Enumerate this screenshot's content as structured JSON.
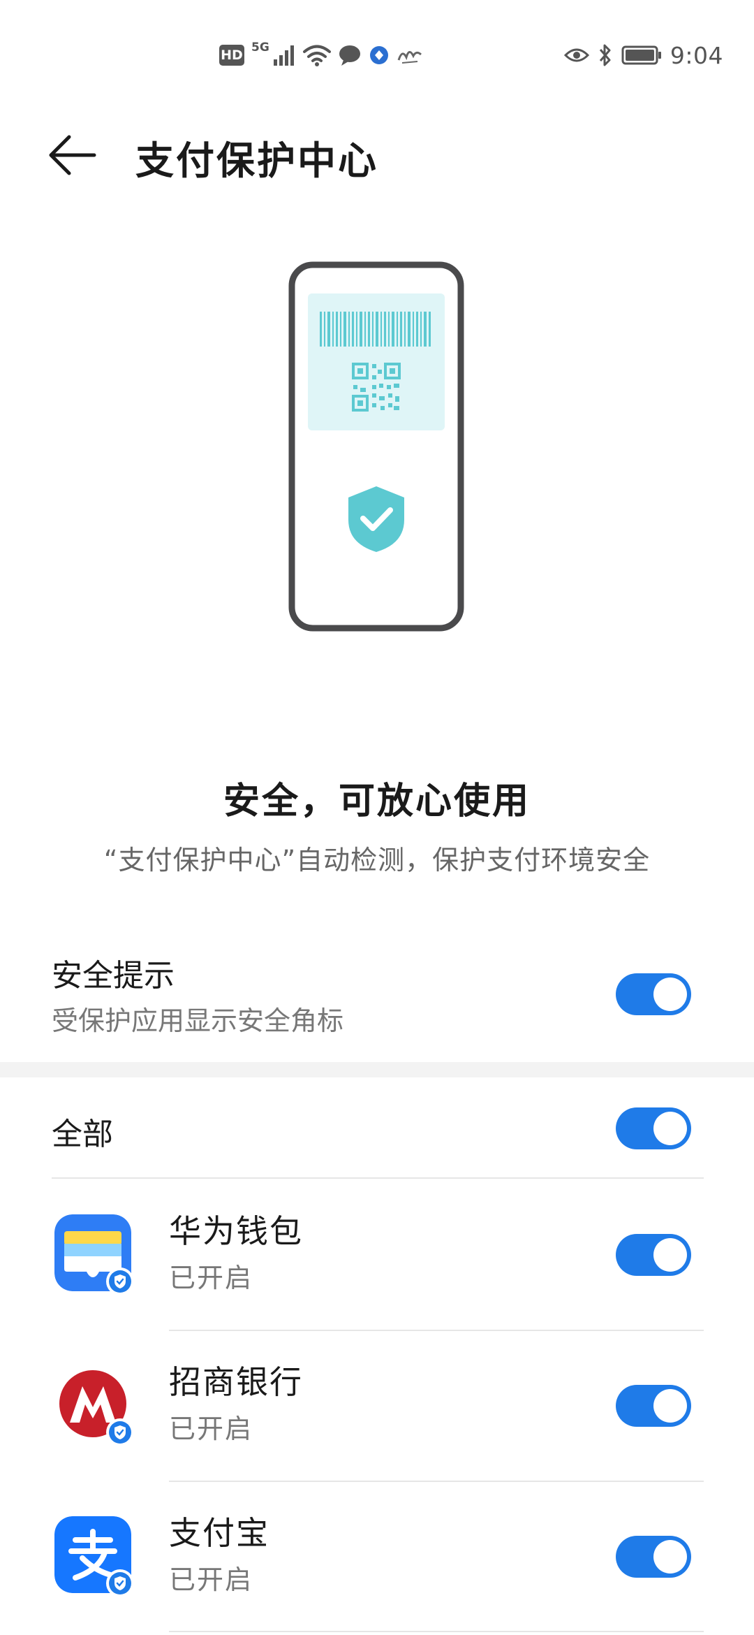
{
  "status_bar": {
    "network_badge": "HD",
    "network_type": "5G",
    "time": "9:04"
  },
  "header": {
    "title": "支付保护中心"
  },
  "status": {
    "title": "安全，可放心使用",
    "subtitle": "“支付保护中心”自动检测，保护支付环境安全"
  },
  "security_tip": {
    "title": "安全提示",
    "description": "受保护应用显示安全角标",
    "enabled": true
  },
  "all_toggle": {
    "label": "全部",
    "enabled": true
  },
  "apps": [
    {
      "name": "华为钱包",
      "status": "已开启",
      "icon": "huawei-wallet-icon",
      "enabled": true
    },
    {
      "name": "招商银行",
      "status": "已开启",
      "icon": "cmb-bank-icon",
      "enabled": true
    },
    {
      "name": "支付宝",
      "status": "已开启",
      "icon": "alipay-icon",
      "enabled": true
    }
  ],
  "colors": {
    "accent": "#1f7be8",
    "shield": "#5cc9d1",
    "qr": "#5cc9d1",
    "qr_bg": "#dff5f7",
    "phone_frame": "#4a4a4c"
  }
}
